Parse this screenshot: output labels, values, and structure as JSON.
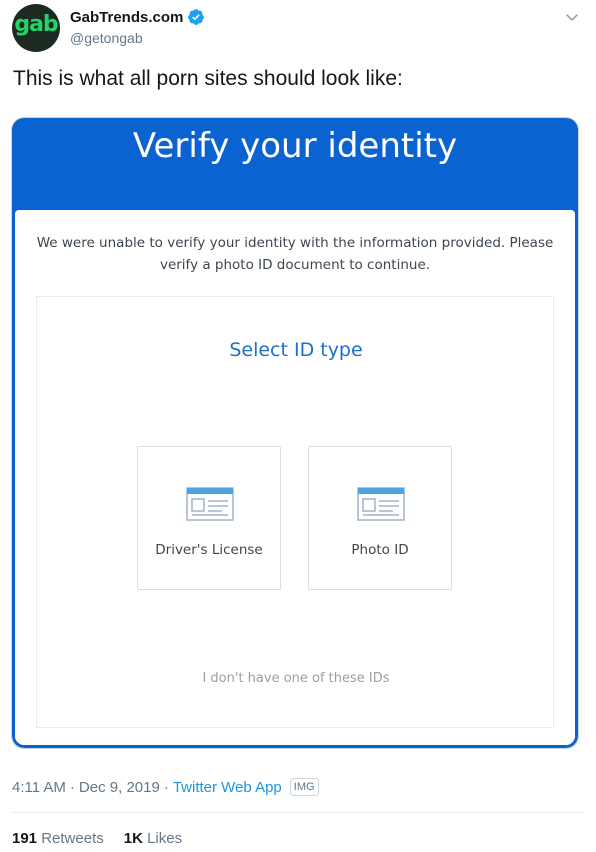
{
  "author": {
    "avatar_text": "gab",
    "display_name": "GabTrends.com",
    "handle": "@getongab"
  },
  "tweet": {
    "text": "This is what all porn sites should look like:"
  },
  "media": {
    "title": "Verify your identity",
    "message": "We were unable to verify your identity with the information provided. Please verify a photo ID document to continue.",
    "select_title": "Select ID type",
    "options": [
      {
        "label": "Driver's License"
      },
      {
        "label": "Photo ID"
      }
    ],
    "no_id_link": "I don't have one of these IDs"
  },
  "meta": {
    "time": "4:11 AM",
    "separator": "·",
    "date": "Dec 9, 2019",
    "source": "Twitter Web App",
    "badge": "IMG"
  },
  "stats": {
    "retweets_count": "191",
    "retweets_label": "Retweets",
    "likes_count": "1K",
    "likes_label": "Likes"
  },
  "colors": {
    "accent": "#1da1f2",
    "link": "#1b95e0",
    "media_blue": "#0b63d1",
    "select_blue": "#1f6fc9",
    "avatar_green": "#25d366"
  }
}
